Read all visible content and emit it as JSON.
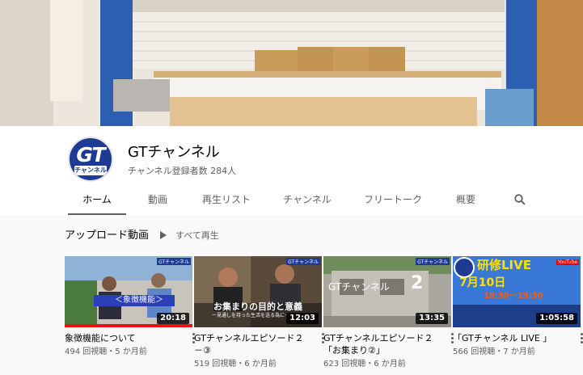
{
  "channel": {
    "name": "GTチャンネル",
    "subscribers": "チャンネル登録者数 284人",
    "avatar_text": "GT",
    "avatar_subtext": "チャンネル"
  },
  "tabs": [
    {
      "label": "ホーム",
      "active": true
    },
    {
      "label": "動画"
    },
    {
      "label": "再生リスト"
    },
    {
      "label": "チャンネル"
    },
    {
      "label": "フリートーク"
    },
    {
      "label": "概要"
    }
  ],
  "tab_search_icon": "search-icon",
  "shelf": {
    "title": "アップロード動画",
    "play_all": "すべて再生",
    "play_icon": "play-icon"
  },
  "videos": [
    {
      "title": "象徴機能について",
      "meta": "494 回視聴・5 か月前",
      "duration": "20:18",
      "thumb_caption": "＜象徴機能＞",
      "thumb_badge": "GTチャンネル"
    },
    {
      "title": "GTチャンネルエピソード２－③",
      "meta": "519 回視聴・6 か月前",
      "duration": "12:03",
      "thumb_caption": "お集まりの目的と意義",
      "thumb_subcaption": "ー見通しを持った生活を送る為にー",
      "thumb_badge": "GTチャンネル"
    },
    {
      "title": "GTチャンネルエピソード２「お集まり②」",
      "meta": "623 回視聴・6 か月前",
      "duration": "13:35",
      "thumb_caption": "GTチャンネル",
      "thumb_number": "2",
      "thumb_badge": "GTチャンネル"
    },
    {
      "title": "「GTチャンネル LIVE 」",
      "meta": "566 回視聴・7 か月前",
      "duration": "1:05:58",
      "thumb_caption": "研修LIVE",
      "thumb_date": "7月10日",
      "thumb_time": "18:30〜19:30",
      "thumb_badge": "YouTube"
    }
  ],
  "colors": {
    "accent": "#1f3a93",
    "text": "#030303",
    "secondary": "#606060"
  }
}
